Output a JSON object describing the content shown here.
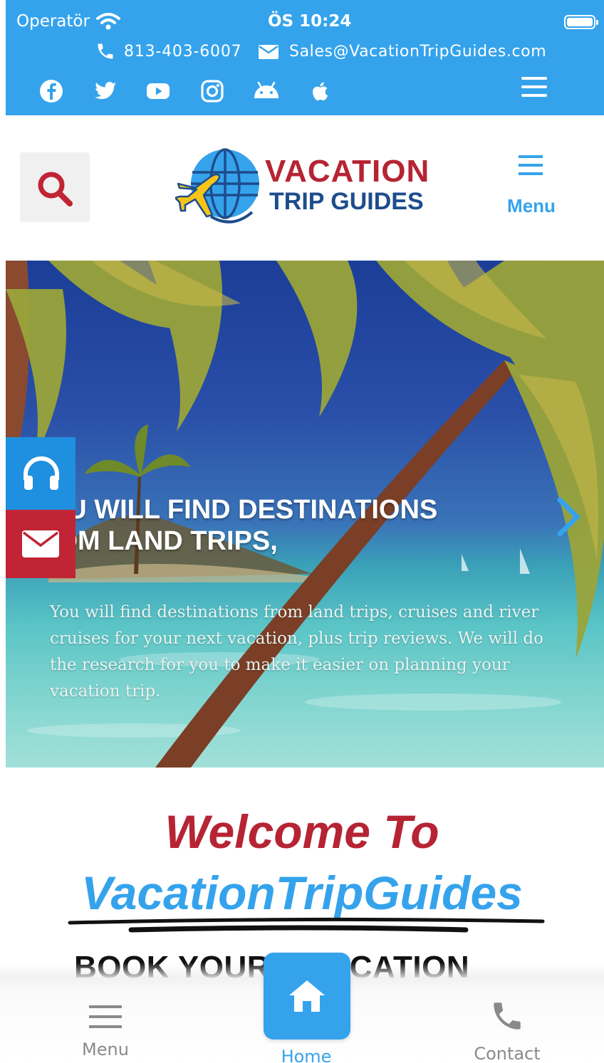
{
  "status_bar": {
    "carrier": "Operatör",
    "time": "ÖS 10:24"
  },
  "top_contact": {
    "phone": "813-403-6007",
    "email": "Sales@VacationTripGuides.com"
  },
  "social_icons": [
    "facebook-icon",
    "twitter-icon",
    "youtube-icon",
    "instagram-icon",
    "android-icon",
    "apple-icon"
  ],
  "header": {
    "logo_line1": "VACATION",
    "logo_line2": "TRIP GUIDES",
    "menu_label": "Menu"
  },
  "hero": {
    "title_line1": "-OU WILL FIND DESTINATIONS",
    "title_line2": "ROM LAND TRIPS,",
    "text": "You will find destinations from land trips, cruises and river cruises for your next vacation, plus trip reviews. We will do the research for you to make it easier on planning your vacation trip."
  },
  "welcome": {
    "line1": "Welcome To",
    "line2": "VacationTripGuides",
    "subheading": "BOOK YOUR      T VACATION"
  },
  "bottom_nav": {
    "menu": "Menu",
    "home": "Home",
    "contact": "Contact"
  },
  "colors": {
    "primary_blue": "#35a3ec",
    "brand_red": "#b62434",
    "brand_navy": "#1d4d8c"
  }
}
